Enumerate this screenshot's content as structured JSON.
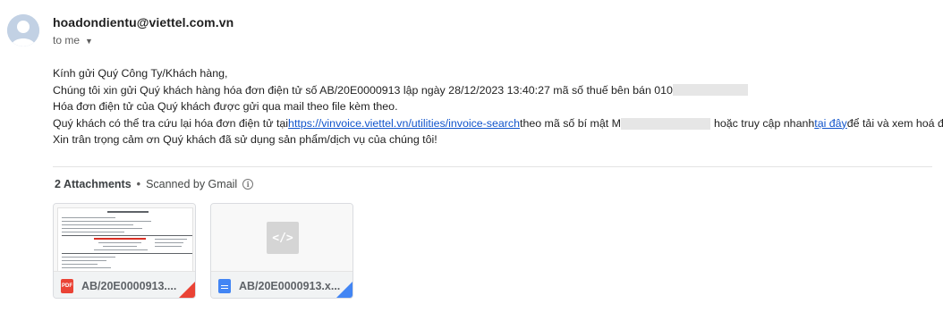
{
  "message": {
    "sender": "hoadondientu@viettel.com.vn",
    "recipient_label": "to me",
    "body": {
      "greeting": "Kính gửi Quý Công Ty/Khách hàng,",
      "line2_prefix": "Chúng tôi xin gửi Quý khách hàng hóa đơn điện tử số AB/20E0000913 lập ngày 28/12/2023 13:40:27 mã số thuế bên bán 010",
      "line3": "Hóa đơn điện tử của Quý khách được gửi qua mail theo file kèm theo.",
      "line4_prefix": "Quý khách có thể tra cứu lại hóa đơn điện tử tại ",
      "line4_link": "https://vinvoice.viettel.vn/utilities/invoice-search",
      "line4_mid": " theo mã số bí mật M",
      "line4_after": "hoặc truy cập nhanh ",
      "line4_link2": "tại đây",
      "line4_suffix": " để tải và xem hoá đơn.",
      "line5": "Xin trân trọng cảm ơn Quý khách đã sử dụng sản phẩm/dịch vụ của chúng tôi!"
    }
  },
  "attachments": {
    "count_label": "2 Attachments",
    "separator": "•",
    "scan_label": "Scanned by Gmail",
    "items": [
      {
        "name": "AB/20E0000913....",
        "type": "pdf",
        "icon": "pdf-file-icon",
        "accent": "#ea4335"
      },
      {
        "name": "AB/20E0000913.x...",
        "type": "xml",
        "icon": "doc-file-icon",
        "accent": "#4285f4"
      }
    ]
  },
  "colors": {
    "link": "#1155cc",
    "pdf": "#ea4335",
    "doc": "#4285f4"
  }
}
